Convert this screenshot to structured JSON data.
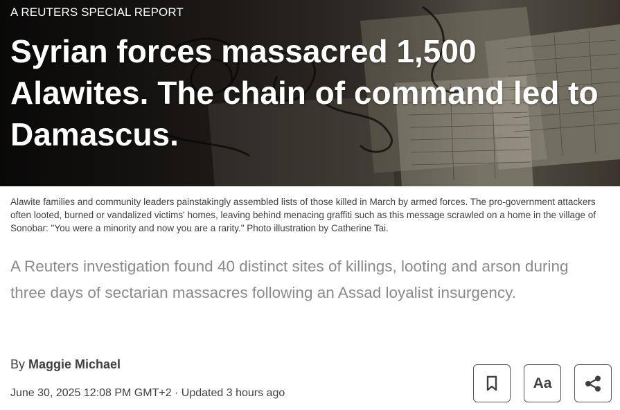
{
  "hero": {
    "kicker": "A REUTERS SPECIAL REPORT",
    "headline": "Syrian forces massacred 1,500 Alawites. The chain of command led to Damascus."
  },
  "caption": "Alawite families and community leaders painstakingly assembled lists of those killed in March by armed forces. The pro-government attackers often looted, burned or vandalized victims' homes, leaving behind menacing graffiti such as this message scrawled on a home in the village of Sonobar: \"You were a minority and now you are a rarity.\" Photo illustration by Catherine Tai.",
  "dek": "A Reuters investigation found 40 distinct sites of killings, looting and arson during three days of sectarian massacres following an Assad loyalist insurgency.",
  "byline": {
    "prefix": "By",
    "author": "Maggie Michael"
  },
  "dateline": "June 30, 2025 12:08 PM GMT+2 · Updated 3 hours ago",
  "toolbar": {
    "save_icon": "bookmark-icon",
    "text_size_label": "Aa",
    "share_icon": "share-icon"
  }
}
